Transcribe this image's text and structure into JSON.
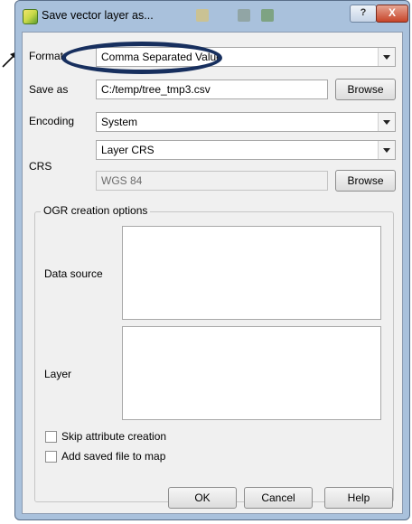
{
  "window": {
    "title": "Save vector layer as...",
    "help_glyph": "?",
    "close_glyph": "X"
  },
  "format": {
    "label": "Format",
    "value": "Comma Separated Value"
  },
  "save_as": {
    "label": "Save as",
    "value": "C:/temp/tree_tmp3.csv",
    "browse_label": "Browse"
  },
  "encoding": {
    "label": "Encoding",
    "value": "System"
  },
  "crs": {
    "label": "CRS",
    "mode_value": "Layer CRS",
    "crs_value": "WGS 84",
    "browse_label": "Browse"
  },
  "ogr": {
    "title": "OGR creation options",
    "data_source_label": "Data source",
    "data_source_value": "",
    "layer_label": "Layer",
    "layer_value": ""
  },
  "checkboxes": {
    "skip_attribute_label": "Skip attribute creation",
    "skip_attribute_checked": false,
    "add_to_map_label": "Add saved file to map",
    "add_to_map_checked": false
  },
  "buttons": {
    "ok": "OK",
    "cancel": "Cancel",
    "help": "Help"
  },
  "colors": {
    "annotation": "#172f5e",
    "frame": "#a9c1dc",
    "close": "#c7452a"
  }
}
